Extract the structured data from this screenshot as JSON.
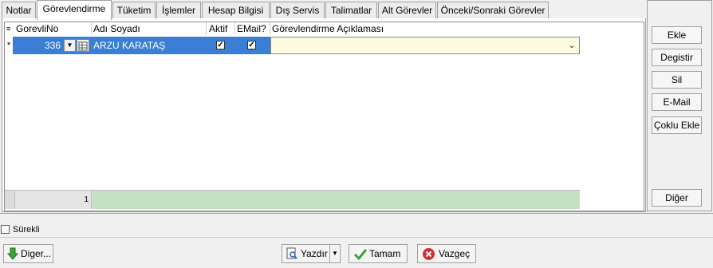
{
  "tabs": [
    {
      "label": "Notlar"
    },
    {
      "label": "Görevlendirme"
    },
    {
      "label": "Tüketim"
    },
    {
      "label": "İşlemler"
    },
    {
      "label": "Hesap Bilgisi"
    },
    {
      "label": "Dış Servis"
    },
    {
      "label": "Talimatlar"
    },
    {
      "label": "Alt Görevler"
    },
    {
      "label": "Önceki/Sonraki Görevler"
    }
  ],
  "grid": {
    "columns": {
      "gorevli_no": "GorevliNo",
      "adi_soyadi": "Adı Soyadı",
      "aktif": "Aktif",
      "email": "EMail?",
      "aciklama": "Görevlendirme Açıklaması"
    },
    "row": {
      "indicator": "*",
      "gorevli_no": "336",
      "adi_soyadi": "ARZU KARATAŞ",
      "aktif": true,
      "email": true,
      "aciklama": ""
    },
    "footer_count": "1"
  },
  "side_buttons": {
    "ekle": "Ekle",
    "degistir": "Degistir",
    "sil": "Sil",
    "email": "E-Mail",
    "coklu_ekle": "Çoklu Ekle",
    "diger": "Diğer"
  },
  "surekli_label": "Sürekli",
  "bottom_buttons": {
    "diger": "Diger...",
    "yazdir": "Yazdır",
    "tamam": "Tamam",
    "vazgec": "Vazgeç"
  },
  "colors": {
    "row_highlight": "#3a7fd5",
    "description_cell": "#fffbe2",
    "footer_bar": "#c2e2c2"
  }
}
